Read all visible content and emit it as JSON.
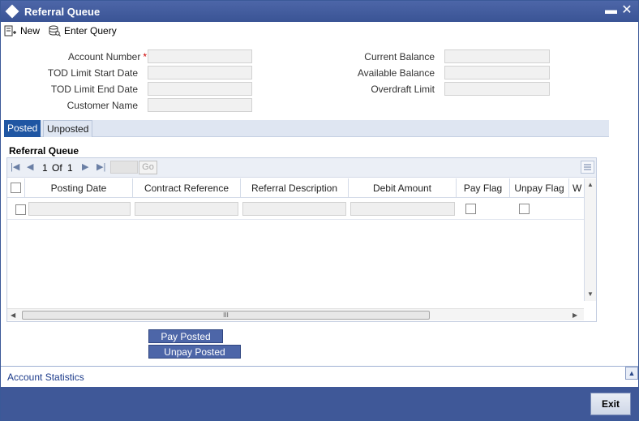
{
  "window": {
    "title": "Referral Queue",
    "minimize_glyph": "▬",
    "close_glyph": "✕"
  },
  "toolbar": {
    "new_label": "New",
    "enter_query_label": "Enter Query"
  },
  "form": {
    "account_number_label": "Account Number",
    "required_marker": "*",
    "tod_limit_start_label": "TOD Limit Start Date",
    "tod_limit_end_label": "TOD Limit End Date",
    "customer_name_label": "Customer Name",
    "current_balance_label": "Current Balance",
    "available_balance_label": "Available Balance",
    "overdraft_limit_label": "Overdraft Limit",
    "account_number_value": "",
    "tod_limit_start_value": "",
    "tod_limit_end_value": "",
    "customer_name_value": "",
    "current_balance_value": "",
    "available_balance_value": "",
    "overdraft_limit_value": ""
  },
  "tabs": [
    {
      "label": "Posted",
      "active": true
    },
    {
      "label": "Unposted",
      "active": false
    }
  ],
  "grid": {
    "title": "Referral Queue",
    "pager": {
      "current_page": "1",
      "of_label": "Of",
      "total_pages": "1",
      "go_label": "Go"
    },
    "columns": [
      "Posting Date",
      "Contract Reference",
      "Referral Description",
      "Debit Amount",
      "Pay Flag",
      "Unpay Flag",
      "W"
    ],
    "rows": [
      {
        "posting_date": "",
        "contract_reference": "",
        "referral_description": "",
        "debit_amount": "",
        "pay_flag": false,
        "unpay_flag": false
      }
    ],
    "hscroll_grip": "III"
  },
  "actions": {
    "pay_posted_label": "Pay Posted",
    "unpay_posted_label": "Unpay Posted"
  },
  "footer": {
    "account_statistics_label": "Account Statistics",
    "exit_label": "Exit"
  },
  "colors": {
    "titlebar": "#3f5898",
    "active_tab": "#1f56a3",
    "button": "#4d66a8",
    "required": "#cc0000"
  }
}
